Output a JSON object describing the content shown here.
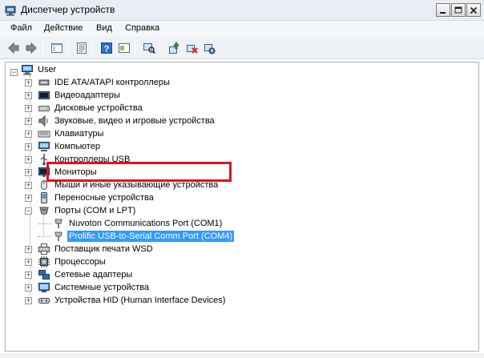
{
  "window": {
    "title": "Диспетчер устройств",
    "icon": "device-manager-icon"
  },
  "menu": [
    "Файл",
    "Действие",
    "Вид",
    "Справка"
  ],
  "toolbar": {
    "icons": [
      "back-arrow-icon",
      "forward-arrow-icon",
      "console-tree-icon",
      "properties-icon",
      "help-icon",
      "show-hide-icon",
      "scan-hardware-icon",
      "update-driver-icon",
      "uninstall-icon",
      "disable-device-icon"
    ]
  },
  "tree": {
    "root": "User",
    "categories": [
      {
        "label": "IDE ATA/ATAPI контроллеры",
        "icon": "ide-controller-icon"
      },
      {
        "label": "Видеоадаптеры",
        "icon": "display-adapter-icon"
      },
      {
        "label": "Дисковые устройства",
        "icon": "disk-drive-icon"
      },
      {
        "label": "Звуковые, видео и игровые устройства",
        "icon": "sound-icon"
      },
      {
        "label": "Клавиатуры",
        "icon": "keyboard-icon"
      },
      {
        "label": "Компьютер",
        "icon": "computer-icon"
      },
      {
        "label": "Контроллеры USB",
        "icon": "usb-icon"
      },
      {
        "label": "Мониторы",
        "icon": "monitor-icon"
      },
      {
        "label": "Мыши и иные указывающие устройства",
        "icon": "mouse-icon"
      },
      {
        "label": "Переносные устройства",
        "icon": "portable-device-icon"
      },
      {
        "label": "Порты (COM и LPT)",
        "icon": "port-icon"
      },
      {
        "label": "Nuvoton Communications Port (COM1)",
        "icon": "com-port-icon"
      },
      {
        "label": "Prolific USB-to-Serial Comm Port (COM4)",
        "icon": "com-port-icon"
      },
      {
        "label": "Поставщик печати WSD",
        "icon": "printer-icon"
      },
      {
        "label": "Процессоры",
        "icon": "processor-icon"
      },
      {
        "label": "Сетевые адаптеры",
        "icon": "network-adapter-icon"
      },
      {
        "label": "Системные устройства",
        "icon": "system-device-icon"
      },
      {
        "label": "Устройства HID (Human Interface Devices)",
        "icon": "hid-icon"
      }
    ]
  },
  "colors": {
    "selection": "#3399ff",
    "highlight_border": "#e0121c"
  }
}
